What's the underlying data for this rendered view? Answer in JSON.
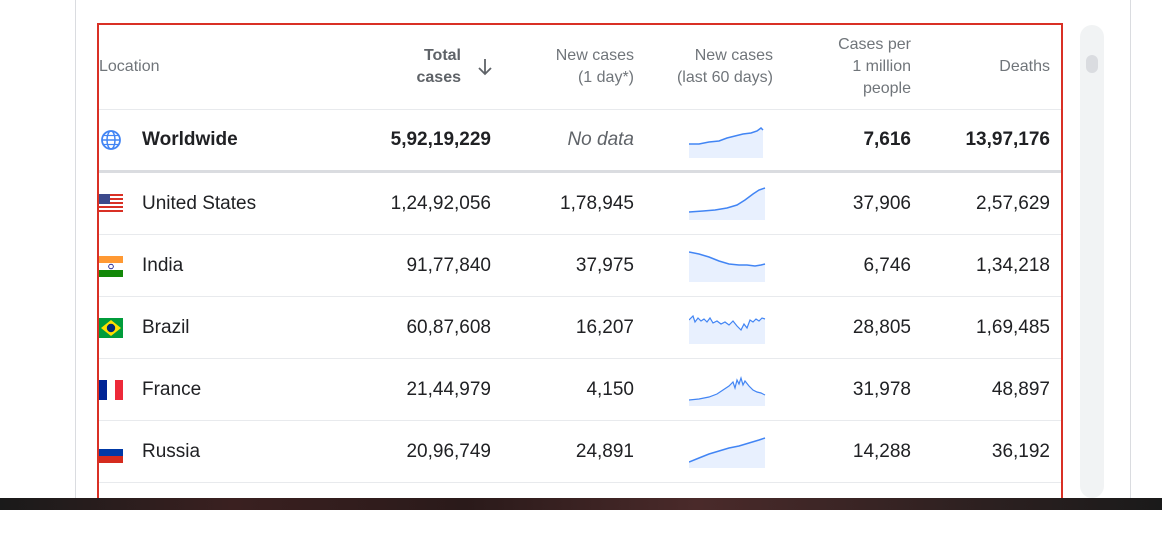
{
  "table": {
    "headers": {
      "location": "Location",
      "total_cases_line1": "Total",
      "total_cases_line2": "cases",
      "new_cases_line1": "New cases",
      "new_cases_line2": "(1 day*)",
      "new_cases_60_line1": "New cases",
      "new_cases_60_line2": "(last 60 days)",
      "per_million_line1": "Cases per",
      "per_million_line2": "1 million",
      "per_million_line3": "people",
      "deaths": "Deaths"
    },
    "sort": {
      "column": "total_cases",
      "direction": "descending",
      "icon": "arrow-down-icon"
    },
    "rows": [
      {
        "location": "Worldwide",
        "icon": "globe-icon",
        "total": "5,92,19,229",
        "new": "No data",
        "per_million": "7,616",
        "deaths": "13,97,176"
      },
      {
        "location": "United States",
        "icon": "flag-us-icon",
        "total": "1,24,92,056",
        "new": "1,78,945",
        "per_million": "37,906",
        "deaths": "2,57,629"
      },
      {
        "location": "India",
        "icon": "flag-india-icon",
        "total": "91,77,840",
        "new": "37,975",
        "per_million": "6,746",
        "deaths": "1,34,218"
      },
      {
        "location": "Brazil",
        "icon": "flag-brazil-icon",
        "total": "60,87,608",
        "new": "16,207",
        "per_million": "28,805",
        "deaths": "1,69,485"
      },
      {
        "location": "France",
        "icon": "flag-france-icon",
        "total": "21,44,979",
        "new": "4,150",
        "per_million": "31,978",
        "deaths": "48,897"
      },
      {
        "location": "Russia",
        "icon": "flag-russia-icon",
        "total": "20,96,749",
        "new": "24,891",
        "per_million": "14,288",
        "deaths": "36,192"
      }
    ]
  },
  "colors": {
    "spark_line": "#4285f4",
    "spark_fill": "#e8f0fe",
    "highlight_border": "#d93025"
  }
}
